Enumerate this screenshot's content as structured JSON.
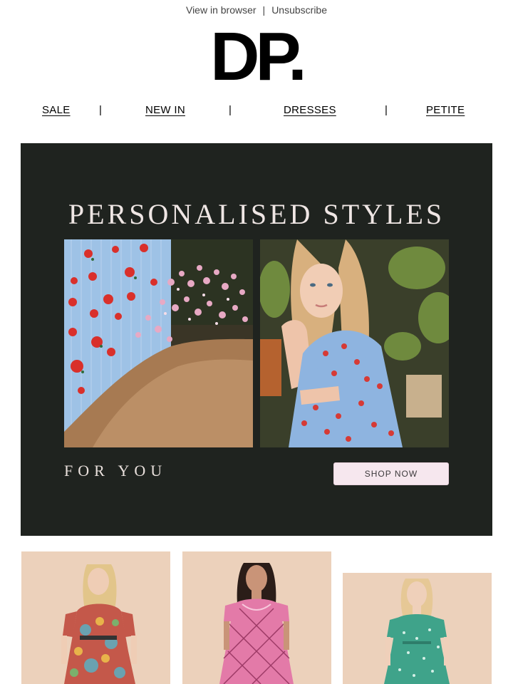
{
  "topbar": {
    "view_in_browser": "View in browser",
    "separator": "|",
    "unsubscribe": "Unsubscribe"
  },
  "brand": {
    "logo_text": "DP."
  },
  "nav": {
    "items": [
      {
        "label": "SALE"
      },
      {
        "label": "NEW IN"
      },
      {
        "label": "DRESSES"
      },
      {
        "label": "PETITE"
      }
    ],
    "separator": "|"
  },
  "hero": {
    "title": "PERSONALISED STYLES",
    "subtitle": "FOR YOU",
    "cta_label": "SHOP NOW",
    "colors": {
      "background": "#1f231f",
      "button": "#f6e7ee",
      "text": "#efe6e4"
    }
  },
  "products": [
    {
      "image": "model-floral-patchwork-dress"
    },
    {
      "image": "model-pink-check-dress"
    },
    {
      "image": "model-green-print-dress"
    }
  ]
}
